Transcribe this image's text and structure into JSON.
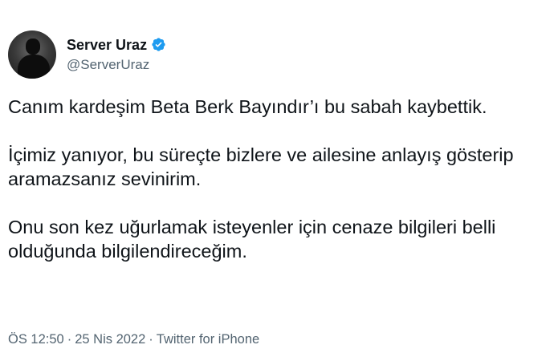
{
  "user": {
    "display_name": "Server Uraz",
    "handle": "@ServerUraz",
    "verified": true,
    "verified_color": "#1d9bf0"
  },
  "tweet": {
    "paragraphs": [
      "Canım kardeşim Beta Berk Bayındır’ı bu sabah kaybettik.",
      "İçimiz yanıyor, bu süreçte bizlere ve ailesine anlayış gösterip aramazsanız sevinirim.",
      "Onu son kez uğurlamak isteyenler için cenaze bilgileri belli olduğunda bilgilendireceğim."
    ],
    "time": "ÖS 12:50",
    "date": "25 Nis 2022",
    "source": "Twitter for iPhone",
    "separator": "·"
  },
  "icons": {
    "verified": "verified-badge-icon",
    "more": "more-options-icon"
  }
}
